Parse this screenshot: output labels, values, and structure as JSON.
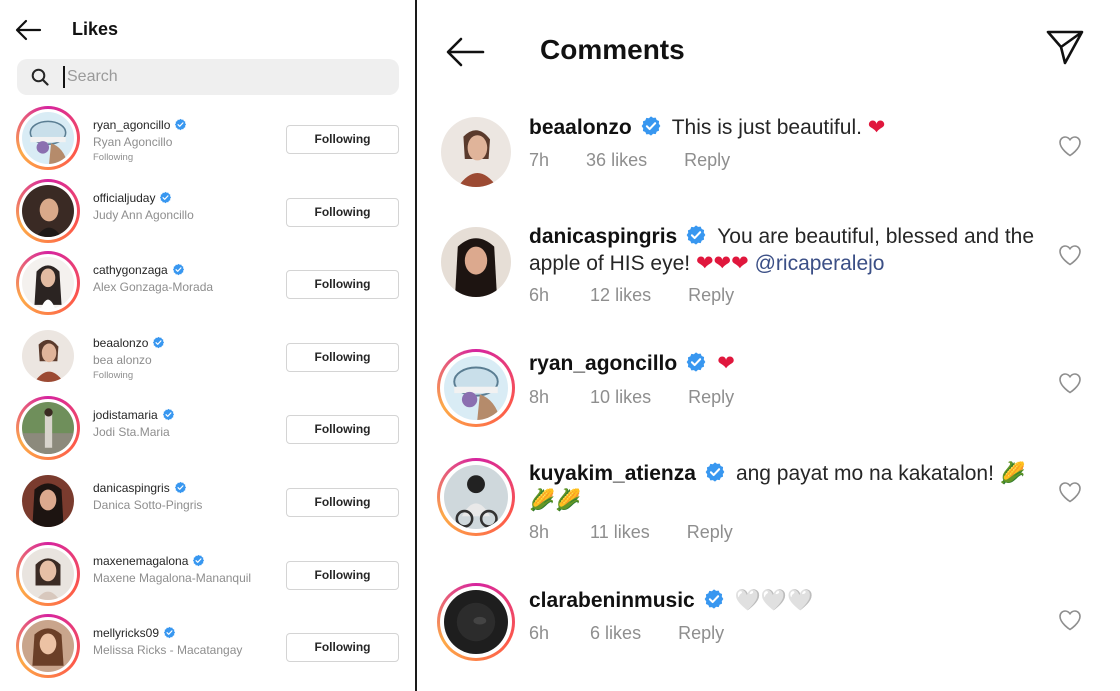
{
  "likes_panel": {
    "title": "Likes",
    "search_placeholder": "Search",
    "rows": [
      {
        "username": "ryan_agoncillo",
        "fullname": "Ryan Agoncillo",
        "sub": "Following",
        "button": "Following"
      },
      {
        "username": "officialjuday",
        "fullname": "Judy Ann Agoncillo",
        "sub": "",
        "button": "Following"
      },
      {
        "username": "cathygonzaga",
        "fullname": "Alex Gonzaga-Morada",
        "sub": "",
        "button": "Following"
      },
      {
        "username": "beaalonzo",
        "fullname": "bea alonzo",
        "sub": "Following",
        "button": "Following"
      },
      {
        "username": "jodistamaria",
        "fullname": "Jodi Sta.Maria",
        "sub": "",
        "button": "Following"
      },
      {
        "username": "danicaspingris",
        "fullname": "Danica Sotto-Pingris",
        "sub": "",
        "button": "Following"
      },
      {
        "username": "maxenemagalona",
        "fullname": "Maxene Magalona-Mananquil",
        "sub": "",
        "button": "Following"
      },
      {
        "username": "mellyricks09",
        "fullname": "Melissa Ricks - Macatangay",
        "sub": "",
        "button": "Following"
      }
    ]
  },
  "comments_panel": {
    "title": "Comments",
    "comments": [
      {
        "username": "beaalonzo",
        "text": "This is just beautiful.",
        "emoji": "❤",
        "mention": "",
        "time": "7h",
        "likes": "36 likes",
        "reply": "Reply"
      },
      {
        "username": "danicaspingris",
        "text": "You are beautiful, blessed and the apple of HIS eye!",
        "emoji": "❤❤❤",
        "mention": "@ricaperalejo",
        "time": "6h",
        "likes": "12 likes",
        "reply": "Reply"
      },
      {
        "username": "ryan_agoncillo",
        "text": "",
        "emoji": "❤",
        "mention": "",
        "time": "8h",
        "likes": "10 likes",
        "reply": "Reply"
      },
      {
        "username": "kuyakim_atienza",
        "text": "ang payat mo na kakatalon!",
        "emoji": "🌽",
        "emoji2": "🌽🌽",
        "mention": "",
        "time": "8h",
        "likes": "11 likes",
        "reply": "Reply"
      },
      {
        "username": "clarabeninmusic",
        "text": "",
        "emoji": "🤍🤍🤍",
        "mention": "",
        "time": "6h",
        "likes": "6 likes",
        "reply": "Reply"
      }
    ]
  },
  "colors": {
    "verified": "#3897f0",
    "heart_red": "#e0173d",
    "muted_text": "#8e8e8e",
    "story_ring": "#d6249f"
  }
}
